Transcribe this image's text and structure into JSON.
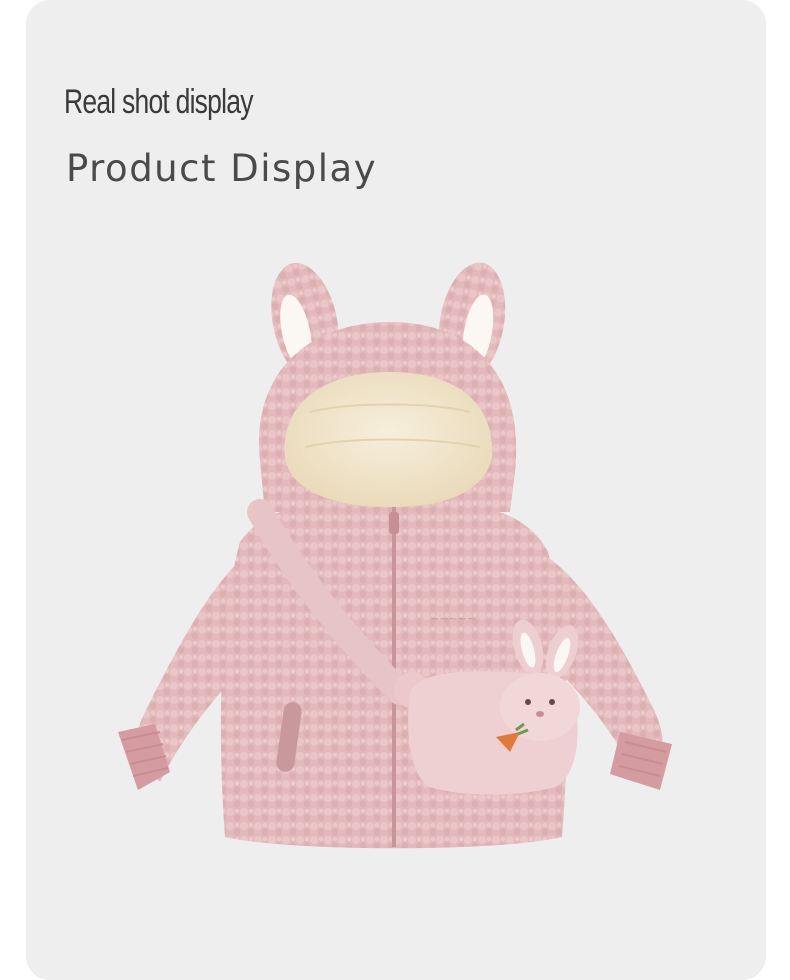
{
  "header": {
    "subtitle": "Real shot display",
    "title": "Product Display"
  },
  "colors": {
    "card_background": "#efeeee",
    "fleece_pink": "#e3b9bc",
    "lining_cream": "#f4ead3",
    "text": "#3a3a3a"
  }
}
